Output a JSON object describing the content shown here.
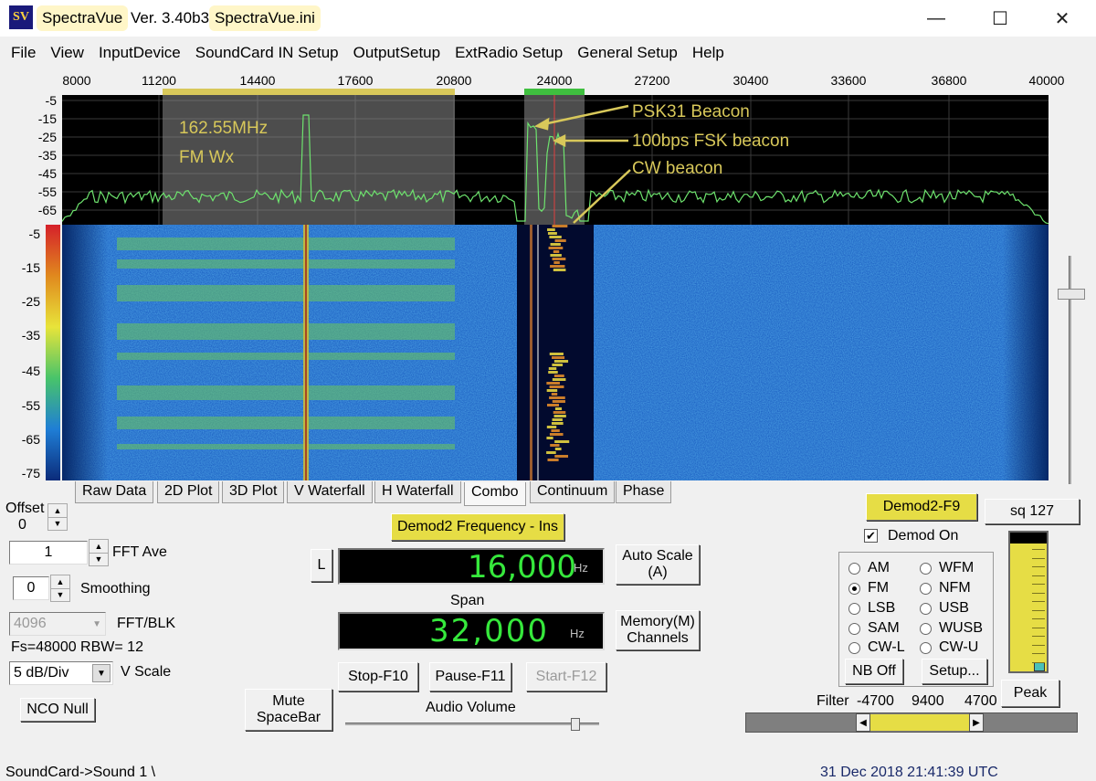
{
  "titlebar": {
    "app_name": "SpectraVue",
    "version": "Ver. 3.40b3",
    "ini_file": "SpectraVue.ini",
    "logo_text": "SV"
  },
  "menu": [
    "File",
    "View",
    "InputDevice",
    "SoundCard IN Setup",
    "OutputSetup",
    "ExtRadio Setup",
    "General Setup",
    "Help"
  ],
  "freq_axis": [
    "8000",
    "11200",
    "14400",
    "17600",
    "20800",
    "24000",
    "27200",
    "30400",
    "33600",
    "36800",
    "40000"
  ],
  "spectrum_db_axis": [
    "-5",
    "-15",
    "-25",
    "-35",
    "-45",
    "-55",
    "-65"
  ],
  "waterfall_db_axis": [
    "-5",
    "-15",
    "-25",
    "-35",
    "-45",
    "-55",
    "-65",
    "-75"
  ],
  "annotations": {
    "fm_freq": "162.55MHz",
    "fm_label": "FM Wx",
    "psk": "PSK31 Beacon",
    "fsk": "100bps FSK beacon",
    "cw": "CW beacon"
  },
  "tabs": [
    "Raw Data",
    "2D Plot",
    "3D Plot",
    "V Waterfall",
    "H Waterfall",
    "Combo",
    "Continuum",
    "Phase"
  ],
  "active_tab": "Combo",
  "left_controls": {
    "offset_label": "Offset",
    "offset_value": "0",
    "fft_ave_value": "1",
    "fft_ave_label": "FFT Ave",
    "smoothing_value": "0",
    "smoothing_label": "Smoothing",
    "fft_blk_value": "4096",
    "fft_blk_label": "FFT/BLK",
    "fs_info": "Fs=48000 RBW=  12",
    "vscale_value": "5 dB/Div",
    "vscale_label": "V Scale",
    "nco_null": "NCO Null"
  },
  "center_controls": {
    "demod2_freq_btn": "Demod2 Frequency - Ins",
    "l_btn": "L",
    "center_freq": "16,000",
    "center_unit": "Hz",
    "auto_scale": "Auto Scale",
    "auto_scale_key": "(A)",
    "span_label": "Span",
    "span_value": "32,000",
    "span_unit": "Hz",
    "memory": "Memory(M)",
    "channels": "Channels",
    "stop": "Stop-F10",
    "pause": "Pause-F11",
    "start": "Start-F12",
    "mute": "Mute",
    "spacebar": "SpaceBar",
    "audio_volume": "Audio Volume",
    "volume_level": 0.92
  },
  "right_controls": {
    "demod2_btn": "Demod2-F9",
    "sq_btn": "sq 127",
    "demod_on_label": "Demod On",
    "demod_on_checked": true,
    "modes_left": [
      "AM",
      "FM",
      "LSB",
      "SAM",
      "CW-L"
    ],
    "modes_right": [
      "WFM",
      "NFM",
      "USB",
      "WUSB",
      "CW-U"
    ],
    "selected_mode": "FM",
    "nb_off": "NB Off",
    "setup": "Setup...",
    "peak": "Peak",
    "filter_label": "Filter",
    "filter_low": "-4700",
    "filter_width": "9400",
    "filter_high": "4700"
  },
  "status": {
    "device": "SoundCard->Sound 1  \\",
    "datetime": "31 Dec 2018  21:41:39 UTC"
  },
  "colors": {
    "accent_yellow": "#e6dd45",
    "trace_green": "#6ee36e",
    "waterfall_blue": "#1f63c4",
    "annotation_gold": "#d8c85a"
  }
}
